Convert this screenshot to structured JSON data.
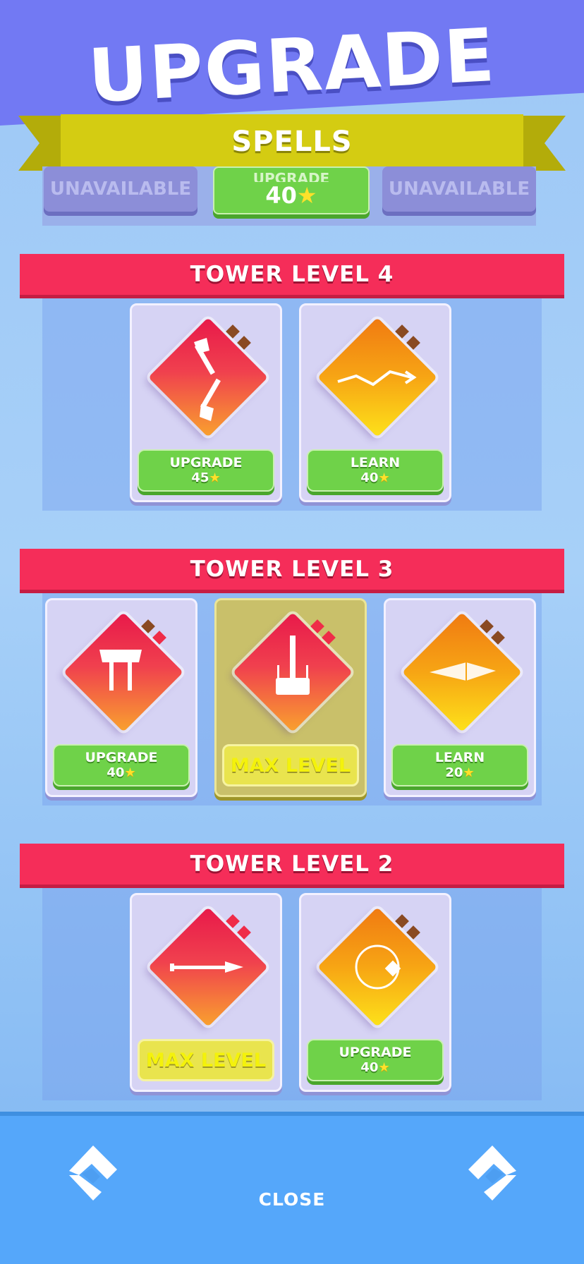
{
  "header": {
    "title": "UPGRADE",
    "banner": "SPELLS"
  },
  "previous_row": {
    "left": "UNAVAILABLE",
    "center": {
      "label": "UPGRADE",
      "cost": "40"
    },
    "right": "UNAVAILABLE"
  },
  "sections": [
    {
      "title": "TOWER LEVEL 4",
      "cards": [
        {
          "icon": "twin-axes-icon",
          "button": "UPGRADE",
          "cost": "45"
        },
        {
          "icon": "zigzag-arrow-icon",
          "button": "LEARN",
          "cost": "40"
        }
      ]
    },
    {
      "title": "TOWER LEVEL 3",
      "cards": [
        {
          "icon": "double-axe-icon",
          "button": "UPGRADE",
          "cost": "40"
        },
        {
          "icon": "hammer-icon",
          "button": "MAX LEVEL"
        },
        {
          "icon": "spear-tip-icon",
          "button": "LEARN",
          "cost": "20"
        }
      ]
    },
    {
      "title": "TOWER LEVEL 2",
      "cards": [
        {
          "icon": "spear-icon",
          "button": "MAX LEVEL"
        },
        {
          "icon": "ring-icon",
          "button": "UPGRADE",
          "cost": "40"
        }
      ]
    }
  ],
  "footer": {
    "close": "CLOSE"
  },
  "colors": {
    "header": "#7279f3",
    "banner": "#d4cc12",
    "section_header": "#f52d59",
    "button": "#6fd249",
    "footer": "#55a7fa"
  }
}
